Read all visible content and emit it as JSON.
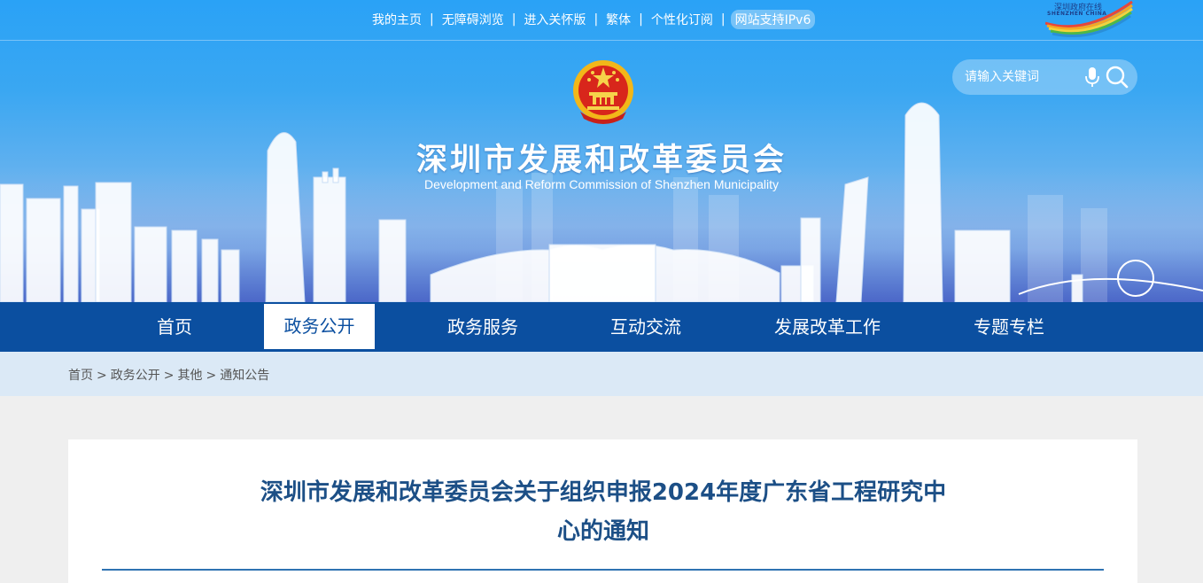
{
  "top_links": {
    "home": "我的主页",
    "accessible": "无障碍浏览",
    "elderly": "进入关怀版",
    "traditional": "繁体",
    "subscribe": "个性化订阅",
    "ipv6": "网站支持IPv6",
    "separator": "|"
  },
  "shenzhen_logo": {
    "line1": "深圳政府在线",
    "line2": "SHENZHEN CHINA"
  },
  "search": {
    "placeholder": "请输入关键词"
  },
  "site": {
    "title": "深圳市发展和改革委员会",
    "subtitle": "Development and Reform Commission of Shenzhen Municipality"
  },
  "nav": {
    "items": [
      {
        "label": "首页"
      },
      {
        "label": "政务公开"
      },
      {
        "label": "政务服务"
      },
      {
        "label": "互动交流"
      },
      {
        "label": "发展改革工作"
      },
      {
        "label": "专题专栏"
      }
    ],
    "active_index": 1
  },
  "breadcrumb": {
    "items": [
      "首页",
      "政务公开",
      "其他",
      "通知公告"
    ],
    "separator": ">"
  },
  "article": {
    "title_line1": "深圳市发展和改革委员会关于组织申报2024年度广东省工程研究中",
    "title_line2": "心的通知"
  },
  "colors": {
    "nav_bg": "#0b4fa0",
    "breadcrumb_bg": "#dbe9f6",
    "title_color": "#1c4f86",
    "rule_color": "#2f73b2",
    "page_bg": "#efefef"
  }
}
